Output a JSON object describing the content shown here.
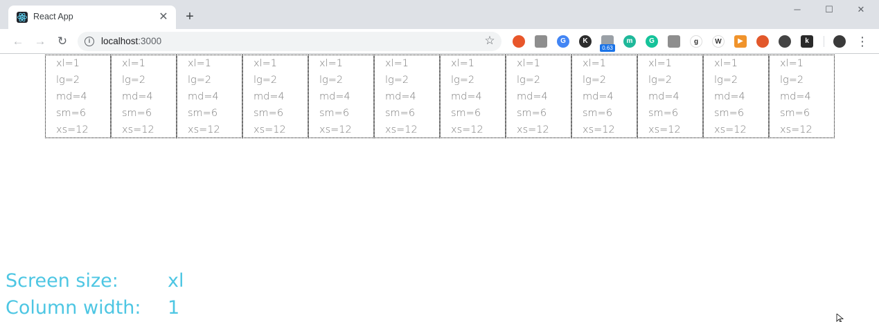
{
  "browser": {
    "tab": {
      "title": "React App",
      "favicon": "react-atom-icon",
      "close_glyph": "✕"
    },
    "new_tab_glyph": "+",
    "window_controls": {
      "minimize": "─",
      "maximize": "☐",
      "close": "✕"
    },
    "toolbar": {
      "back_glyph": "←",
      "forward_glyph": "→",
      "reload_glyph": "↻",
      "url_host": "localhost",
      "url_port": ":3000",
      "bookmark_glyph": "☆",
      "extension_badge": "0.63",
      "menu_glyph": "⋮"
    },
    "extensions": [
      {
        "name": "ublock-icon",
        "glyph": "",
        "color": "#e8562a"
      },
      {
        "name": "camera-icon",
        "glyph": "",
        "color": "#8e8e8e"
      },
      {
        "name": "translate-icon",
        "glyph": "G",
        "color": "#4285f4"
      },
      {
        "name": "k-circle-icon",
        "glyph": "K",
        "color": "#2d2d2d"
      },
      {
        "name": "speed-gauge-icon",
        "glyph": "",
        "color": "#9aa0a6"
      },
      {
        "name": "m-circle-icon",
        "glyph": "m",
        "color": "#1fb89a"
      },
      {
        "name": "grammarly-icon",
        "glyph": "G",
        "color": "#15c39a"
      },
      {
        "name": "layers-icon",
        "glyph": "",
        "color": "#8e8e8e"
      },
      {
        "name": "g-letter-icon",
        "glyph": "g",
        "color": "#ffffff"
      },
      {
        "name": "wikipedia-icon",
        "glyph": "W",
        "color": "#ffffff"
      },
      {
        "name": "play-circle-icon",
        "glyph": "▶",
        "color": "#f0932b"
      },
      {
        "name": "pattern-icon",
        "glyph": "",
        "color": "#e2582b"
      },
      {
        "name": "pocket-icon",
        "glyph": "",
        "color": "#444444"
      },
      {
        "name": "k-square-icon",
        "glyph": "k",
        "color": "#2a2a2a"
      }
    ]
  },
  "grid": {
    "columns": [
      {
        "lines": [
          "xl=1",
          "lg=2",
          "md=4",
          "sm=6",
          "xs=12"
        ]
      },
      {
        "lines": [
          "xl=1",
          "lg=2",
          "md=4",
          "sm=6",
          "xs=12"
        ]
      },
      {
        "lines": [
          "xl=1",
          "lg=2",
          "md=4",
          "sm=6",
          "xs=12"
        ]
      },
      {
        "lines": [
          "xl=1",
          "lg=2",
          "md=4",
          "sm=6",
          "xs=12"
        ]
      },
      {
        "lines": [
          "xl=1",
          "lg=2",
          "md=4",
          "sm=6",
          "xs=12"
        ]
      },
      {
        "lines": [
          "xl=1",
          "lg=2",
          "md=4",
          "sm=6",
          "xs=12"
        ]
      },
      {
        "lines": [
          "xl=1",
          "lg=2",
          "md=4",
          "sm=6",
          "xs=12"
        ]
      },
      {
        "lines": [
          "xl=1",
          "lg=2",
          "md=4",
          "sm=6",
          "xs=12"
        ]
      },
      {
        "lines": [
          "xl=1",
          "lg=2",
          "md=4",
          "sm=6",
          "xs=12"
        ]
      },
      {
        "lines": [
          "xl=1",
          "lg=2",
          "md=4",
          "sm=6",
          "xs=12"
        ]
      },
      {
        "lines": [
          "xl=1",
          "lg=2",
          "md=4",
          "sm=6",
          "xs=12"
        ]
      },
      {
        "lines": [
          "xl=1",
          "lg=2",
          "md=4",
          "sm=6",
          "xs=12"
        ]
      }
    ]
  },
  "status": {
    "screen_size_label": "Screen size:",
    "screen_size_value": "xl",
    "column_width_label": "Column width:",
    "column_width_value": "1"
  },
  "colors": {
    "accent": "#4dc6e3",
    "cell_text": "#7a7a7a",
    "cell_border": "#000000"
  }
}
